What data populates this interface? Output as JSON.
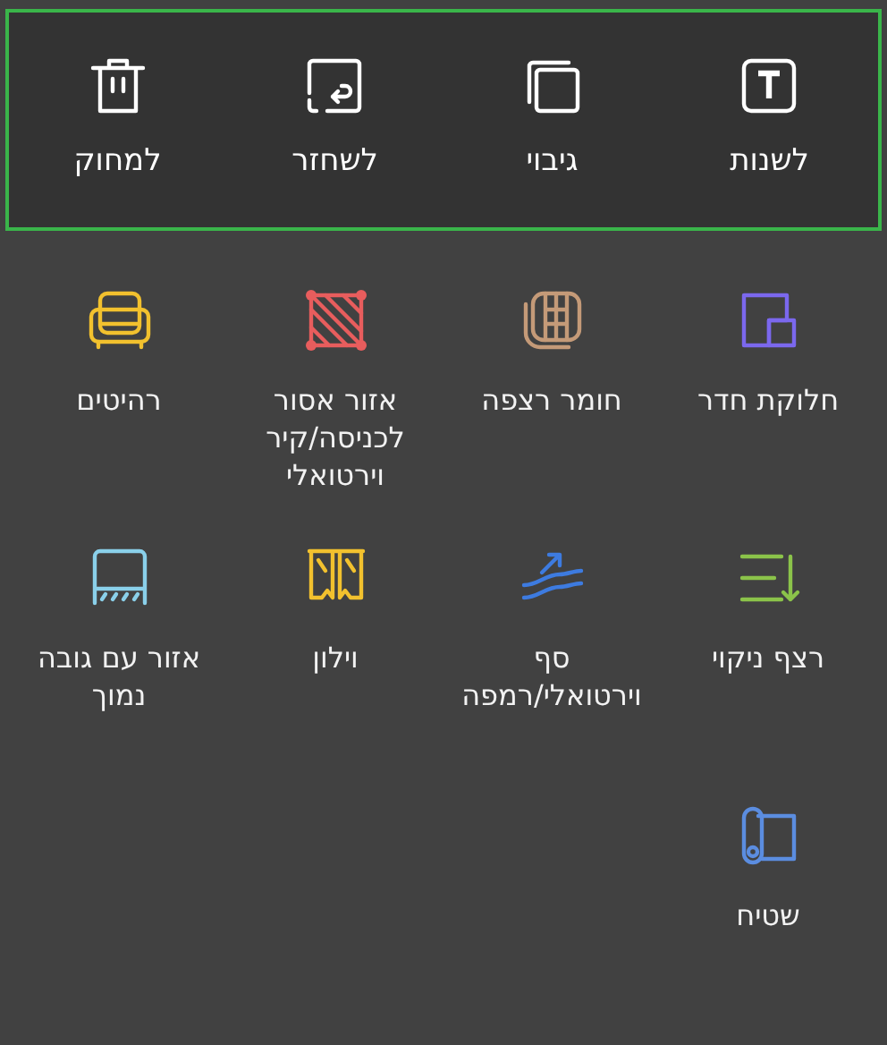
{
  "actions": [
    {
      "label": "לשנות"
    },
    {
      "label": "גיבוי"
    },
    {
      "label": "לשחזר"
    },
    {
      "label": "למחוק"
    }
  ],
  "tools": [
    {
      "label": "חלוקת חדר",
      "color": "#7b68ee"
    },
    {
      "label": "חומר רצפה",
      "color": "#c49a78"
    },
    {
      "label": "אזור אסור לכניסה/קיר וירטואלי",
      "color": "#e85d5d"
    },
    {
      "label": "רהיטים",
      "color": "#f2c12e"
    },
    {
      "label": "רצף ניקוי",
      "color": "#8bc34a"
    },
    {
      "label": "סף וירטואלי/רמפה",
      "color": "#3d7be0"
    },
    {
      "label": "וילון",
      "color": "#f2c12e"
    },
    {
      "label": "אזור עם גובה נמוך",
      "color": "#8ad0ea"
    },
    {
      "label": "שטיח",
      "color": "#5b8de0"
    }
  ]
}
